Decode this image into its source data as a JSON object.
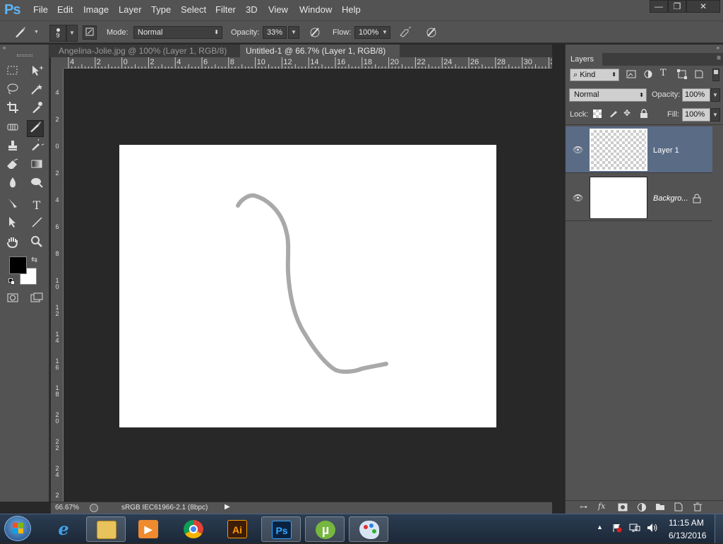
{
  "app": {
    "logo": "Ps",
    "menu": [
      "File",
      "Edit",
      "Image",
      "Layer",
      "Type",
      "Select",
      "Filter",
      "3D",
      "View",
      "Window",
      "Help"
    ],
    "window_controls": {
      "minimize": "—",
      "restore": "❐",
      "close": "✕"
    }
  },
  "options_bar": {
    "brush_size": "9",
    "mode_label": "Mode:",
    "mode_value": "Normal",
    "opacity_label": "Opacity:",
    "opacity_value": "33%",
    "flow_label": "Flow:",
    "flow_value": "100%"
  },
  "tabs": [
    {
      "label": "Angelina-Jolie.jpg @ 100% (Layer 1, RGB/8) *",
      "close": "×",
      "active": false
    },
    {
      "label": "Untitled-1 @ 66.7% (Layer 1, RGB/8) *",
      "close": "×",
      "active": true
    }
  ],
  "ruler": {
    "top": [
      "4",
      "2",
      "0",
      "2",
      "4",
      "6",
      "8",
      "10",
      "12",
      "14",
      "16",
      "18",
      "20",
      "22",
      "24",
      "26",
      "28",
      "30",
      "3"
    ],
    "left": [
      "4",
      "2",
      "0",
      "2",
      "4",
      "6",
      "8",
      "10",
      "12",
      "14",
      "16",
      "18",
      "20",
      "22",
      "24",
      "2"
    ]
  },
  "status": {
    "zoom": "66.67%",
    "profile": "sRGB IEC61966-2.1 (8bpc)"
  },
  "layers_panel": {
    "title": "Layers",
    "kind_label": "Kind",
    "blend_mode": "Normal",
    "opacity_label": "Opacity:",
    "opacity_value": "100%",
    "lock_label": "Lock:",
    "fill_label": "Fill:",
    "fill_value": "100%",
    "layers": [
      {
        "name": "Layer 1",
        "selected": true,
        "transparent": true
      },
      {
        "name": "Backgro...",
        "selected": false,
        "transparent": false
      }
    ]
  },
  "colors": {
    "foreground": "#000000",
    "background": "#ffffff",
    "stroke": "#a9a9a9",
    "selected_layer": "#5a6b85"
  },
  "taskbar": {
    "apps": [
      "start-orb",
      "internet-explorer",
      "file-explorer",
      "media-player",
      "chrome",
      "illustrator",
      "photoshop",
      "utorrent",
      "paint"
    ],
    "illustrator_label": "Ai",
    "photoshop_label": "Ps",
    "time": "11:15 AM",
    "date": "6/13/2016"
  }
}
